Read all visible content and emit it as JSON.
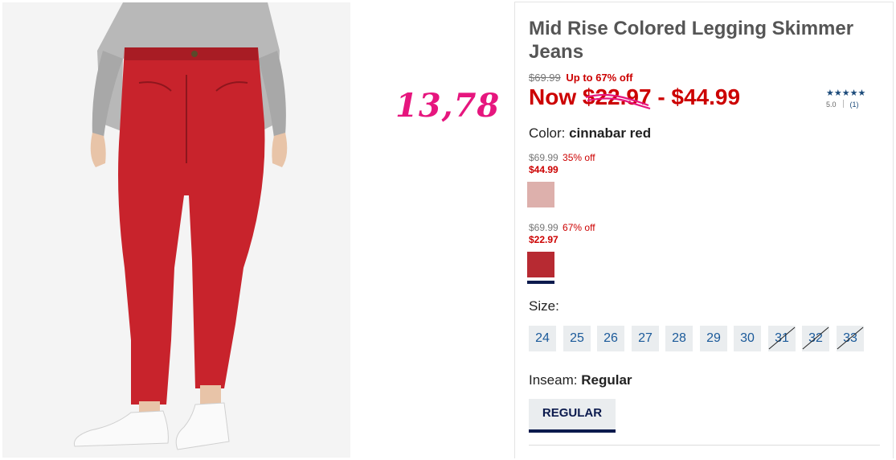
{
  "product": {
    "title": "Mid Rise Colored Legging Skimmer Jeans",
    "image_alt": "Model wearing red skinny jeans and white sneakers"
  },
  "annotation": {
    "handwritten_text": "13,78"
  },
  "price": {
    "original": "$69.99",
    "discount_label": "Up to 67% off",
    "now_prefix": "Now",
    "low": "$22.97",
    "separator": "-",
    "high": "$44.99"
  },
  "rating": {
    "stars": "★★★★★",
    "score": "5.0",
    "count": "(1)"
  },
  "color": {
    "label": "Color:",
    "selected": "cinnabar red",
    "variants": [
      {
        "original": "$69.99",
        "off": "35% off",
        "now": "$44.99",
        "swatch_color": "#ddb0ac"
      },
      {
        "original": "$69.99",
        "off": "67% off",
        "now": "$22.97",
        "swatch_color": "#b72a32"
      }
    ]
  },
  "size": {
    "label": "Size:",
    "options": [
      {
        "value": "24",
        "available": true
      },
      {
        "value": "25",
        "available": true
      },
      {
        "value": "26",
        "available": true
      },
      {
        "value": "27",
        "available": true
      },
      {
        "value": "28",
        "available": true
      },
      {
        "value": "29",
        "available": true
      },
      {
        "value": "30",
        "available": true
      },
      {
        "value": "31",
        "available": false
      },
      {
        "value": "32",
        "available": false
      },
      {
        "value": "33",
        "available": false
      }
    ]
  },
  "inseam": {
    "label": "Inseam:",
    "selected": "Regular",
    "button": "REGULAR"
  },
  "colors": {
    "sale_red": "#cc0000",
    "navy": "#0b1a4d",
    "link_blue": "#1b5a9a",
    "annotation_pink": "#e6167e"
  }
}
